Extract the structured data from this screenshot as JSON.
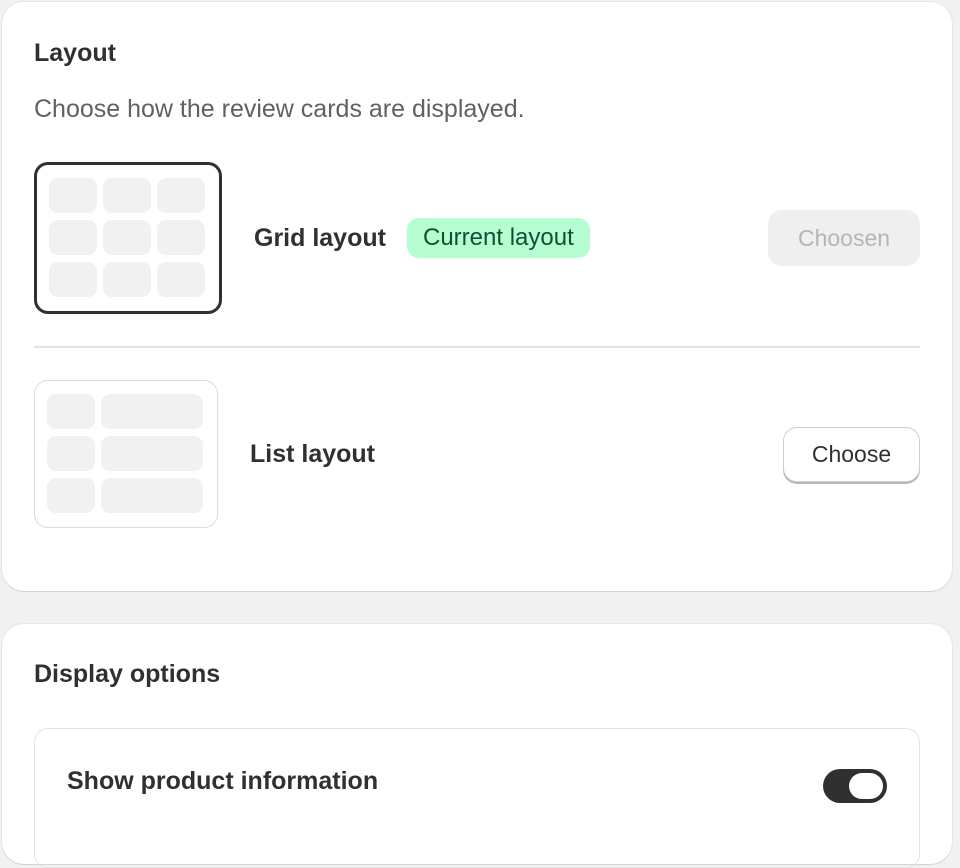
{
  "layout_card": {
    "title": "Layout",
    "subtitle": "Choose how the review cards are displayed.",
    "options": [
      {
        "label": "Grid layout",
        "badge": "Current layout",
        "button_label": "Choosen",
        "selected": true
      },
      {
        "label": "List layout",
        "button_label": "Choose",
        "selected": false
      }
    ]
  },
  "display_card": {
    "title": "Display options",
    "settings": [
      {
        "label": "Show product information",
        "enabled": true
      }
    ]
  },
  "colors": {
    "badge_bg": "#b4fed2",
    "badge_text": "#0c5132",
    "toggle_on": "#303030",
    "page_bg": "#f1f1f1"
  }
}
